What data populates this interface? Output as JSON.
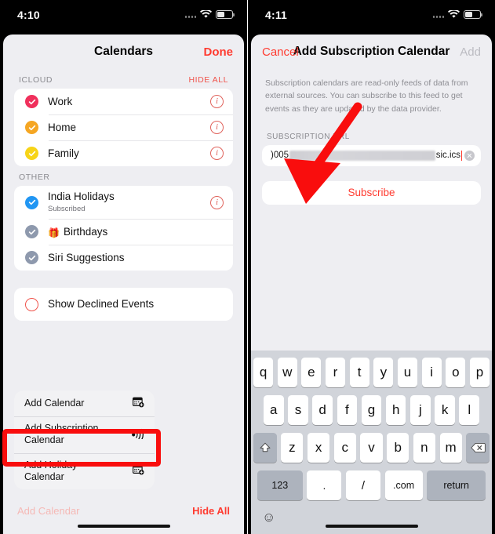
{
  "left_phone": {
    "status_bar": {
      "time": "4:10",
      "wifi_icon": "wifi-icon",
      "battery_icon": "battery-icon",
      "signal_icon": "signal-dots-icon"
    },
    "nav": {
      "title": "Calendars",
      "right_action": "Done"
    },
    "sections": [
      {
        "header": "ICLOUD",
        "action": "HIDE ALL",
        "rows": [
          {
            "title": "Work",
            "subtitle": "",
            "color": "#f0305c",
            "check_style": "filled",
            "info": true
          },
          {
            "title": "Home",
            "subtitle": "",
            "color": "#f5a623",
            "check_style": "filled",
            "info": true
          },
          {
            "title": "Family",
            "subtitle": "",
            "color": "#f7d417",
            "check_style": "filled",
            "info": true
          }
        ]
      },
      {
        "header": "OTHER",
        "action": "",
        "rows": [
          {
            "title": "India Holidays",
            "subtitle": "Subscribed",
            "color": "#2196f3",
            "check_style": "filled",
            "info": true
          },
          {
            "title": "Birthdays",
            "subtitle": "",
            "color": "#8e99ad",
            "check_style": "muted",
            "info": false,
            "leading_icon": "gift-icon"
          },
          {
            "title": "Siri Suggestions",
            "subtitle": "",
            "color": "#8e99ad",
            "check_style": "muted",
            "info": false
          }
        ]
      },
      {
        "header": "",
        "action": "",
        "rows": [
          {
            "title": "Show Declined Events",
            "subtitle": "",
            "color": "#f0544c",
            "check_style": "hollow",
            "info": false
          }
        ]
      }
    ],
    "menu": {
      "items": [
        {
          "label": "Add Calendar",
          "icon": "calendar-add-icon",
          "highlighted": false
        },
        {
          "label": "Add Subscription Calendar",
          "icon": "rss-subscribe-icon",
          "highlighted": true
        },
        {
          "label": "Add Holiday Calendar",
          "icon": "calendar-add-icon",
          "highlighted": false
        }
      ]
    },
    "bottom_bar": {
      "add_label": "Add Calendar",
      "hide_label": "Hide All"
    }
  },
  "right_phone": {
    "status_bar": {
      "time": "4:11",
      "wifi_icon": "wifi-icon",
      "battery_icon": "battery-icon",
      "signal_icon": "signal-dots-icon"
    },
    "nav": {
      "left_action": "Cancel",
      "title": "Add Subscription Calendar",
      "right_action": "Add"
    },
    "description": "Subscription calendars are read-only feeds of data from external sources. You can subscribe to this feed to get events as they are updated by the data provider.",
    "field": {
      "label": "SUBSCRIPTION URL",
      "value_prefix": ")005",
      "value_suffix": "sic.ics",
      "redacted": true,
      "clear_icon": "clear-field-icon"
    },
    "subscribe_button": "Subscribe",
    "keyboard": {
      "row1": [
        "q",
        "w",
        "e",
        "r",
        "t",
        "y",
        "u",
        "i",
        "o",
        "p"
      ],
      "row2": [
        "a",
        "s",
        "d",
        "f",
        "g",
        "h",
        "j",
        "k",
        "l"
      ],
      "row3": [
        "z",
        "x",
        "c",
        "v",
        "b",
        "n",
        "m"
      ],
      "shift_icon": "shift-icon",
      "backspace_icon": "backspace-icon",
      "num_key": "123",
      "period_key": ".",
      "slash_key": "/",
      "dotcom_key": ".com",
      "return_key": "return",
      "emoji_icon": "emoji-icon"
    }
  },
  "annotations": {
    "arrow_color": "#f90d0d",
    "highlight_color": "#f90d0d"
  }
}
